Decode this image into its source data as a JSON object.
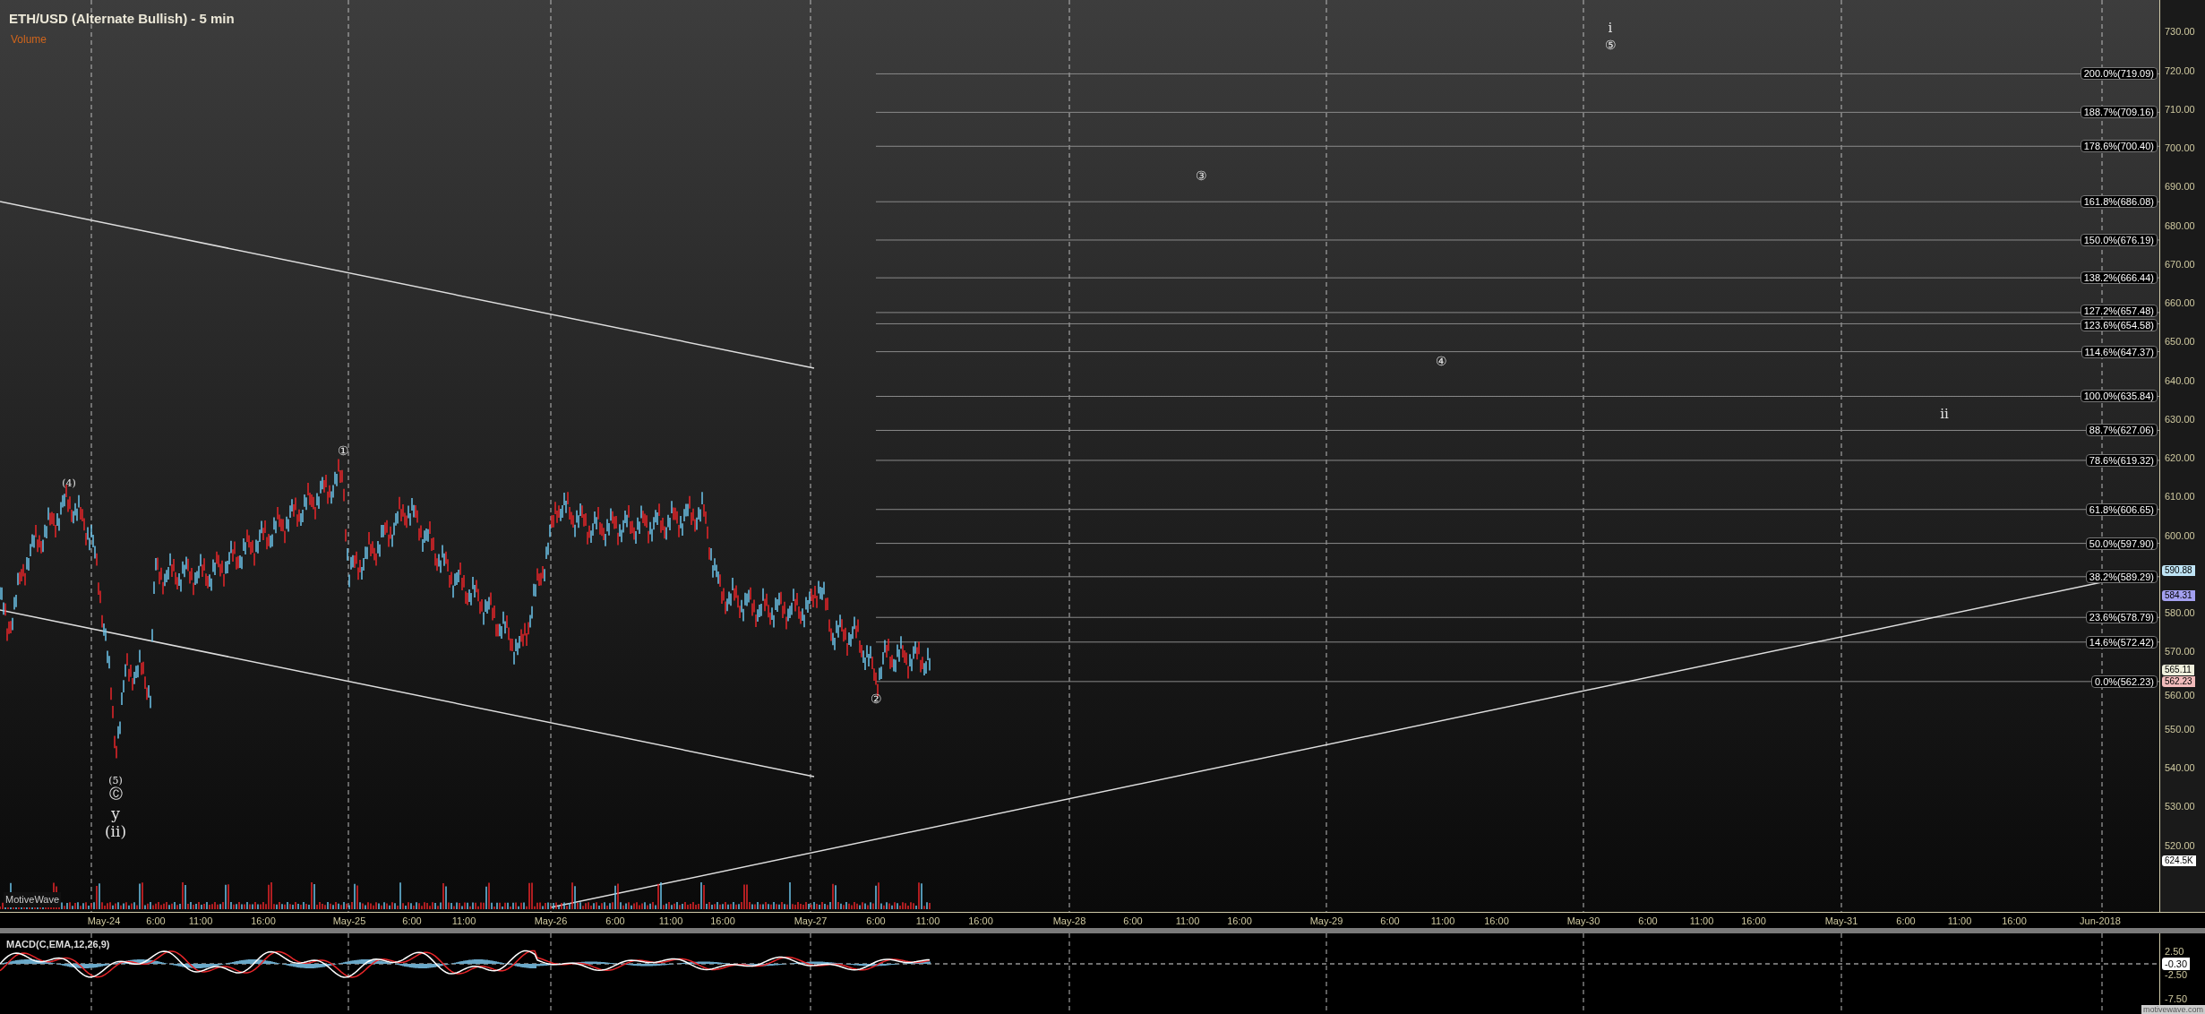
{
  "chart": {
    "title": "ETH/USD (Alternate Bullish) - 5 min",
    "study_label": "Volume",
    "volume_label": "MotiveWave",
    "price_axis": [
      "730.00",
      "720.00",
      "710.00",
      "700.00",
      "690.00",
      "680.00",
      "670.00",
      "660.00",
      "650.00",
      "640.00",
      "630.00",
      "620.00",
      "610.00",
      "600.00",
      "580.00",
      "570.00",
      "560.00",
      "550.00",
      "540.00",
      "530.00",
      "520.00"
    ],
    "fib_levels": [
      {
        "label": "200.0%(719.09)"
      },
      {
        "label": "188.7%(709.16)"
      },
      {
        "label": "178.6%(700.40)"
      },
      {
        "label": "161.8%(686.08)"
      },
      {
        "label": "150.0%(676.19)"
      },
      {
        "label": "138.2%(666.44)"
      },
      {
        "label": "127.2%(657.48)"
      },
      {
        "label": "123.6%(654.58)"
      },
      {
        "label": "114.6%(647.37)"
      },
      {
        "label": "100.0%(635.84)"
      },
      {
        "label": "88.7%(627.06)"
      },
      {
        "label": "78.6%(619.32)"
      },
      {
        "label": "61.8%(606.65)"
      },
      {
        "label": "50.0%(597.90)"
      },
      {
        "label": "38.2%(589.29)"
      },
      {
        "label": "23.6%(578.79)"
      },
      {
        "label": "14.6%(572.42)"
      },
      {
        "label": "0.0%(562.23)"
      }
    ],
    "price_markers": [
      {
        "text": "590.88",
        "color": "#bfe4f5"
      },
      {
        "text": "584.31",
        "color": "#a3a0f0"
      },
      {
        "text": "565.11",
        "color": "#efefdc"
      },
      {
        "text": "562.23",
        "color": "#f2bcbc"
      },
      {
        "text": "624.5K",
        "color": "#ffffff"
      }
    ],
    "wave_labels": [
      {
        "text": "(4)"
      },
      {
        "text": "(5)"
      },
      {
        "text": "Ⓒ"
      },
      {
        "text": "y"
      },
      {
        "text": "(ii)"
      },
      {
        "text": "①"
      },
      {
        "text": "②"
      },
      {
        "text": "③"
      },
      {
        "text": "④"
      },
      {
        "text": "⑤"
      },
      {
        "text": "i"
      },
      {
        "text": "ii"
      }
    ]
  },
  "time_axis": [
    "May-24",
    "6:00",
    "11:00",
    "16:00",
    "May-25",
    "6:00",
    "11:00",
    "May-26",
    "6:00",
    "11:00",
    "16:00",
    "May-27",
    "6:00",
    "11:00",
    "16:00",
    "May-28",
    "6:00",
    "11:00",
    "16:00",
    "May-29",
    "6:00",
    "11:00",
    "16:00",
    "May-30",
    "6:00",
    "11:00",
    "16:00",
    "May-31",
    "6:00",
    "11:00",
    "16:00",
    "Jun-2018"
  ],
  "macd": {
    "title": "MACD(C,EMA,12,26,9)",
    "axis": [
      "2.50",
      "-2.50",
      "-7.50"
    ],
    "marker": "-0.30"
  },
  "branding": "motivewave.com"
}
